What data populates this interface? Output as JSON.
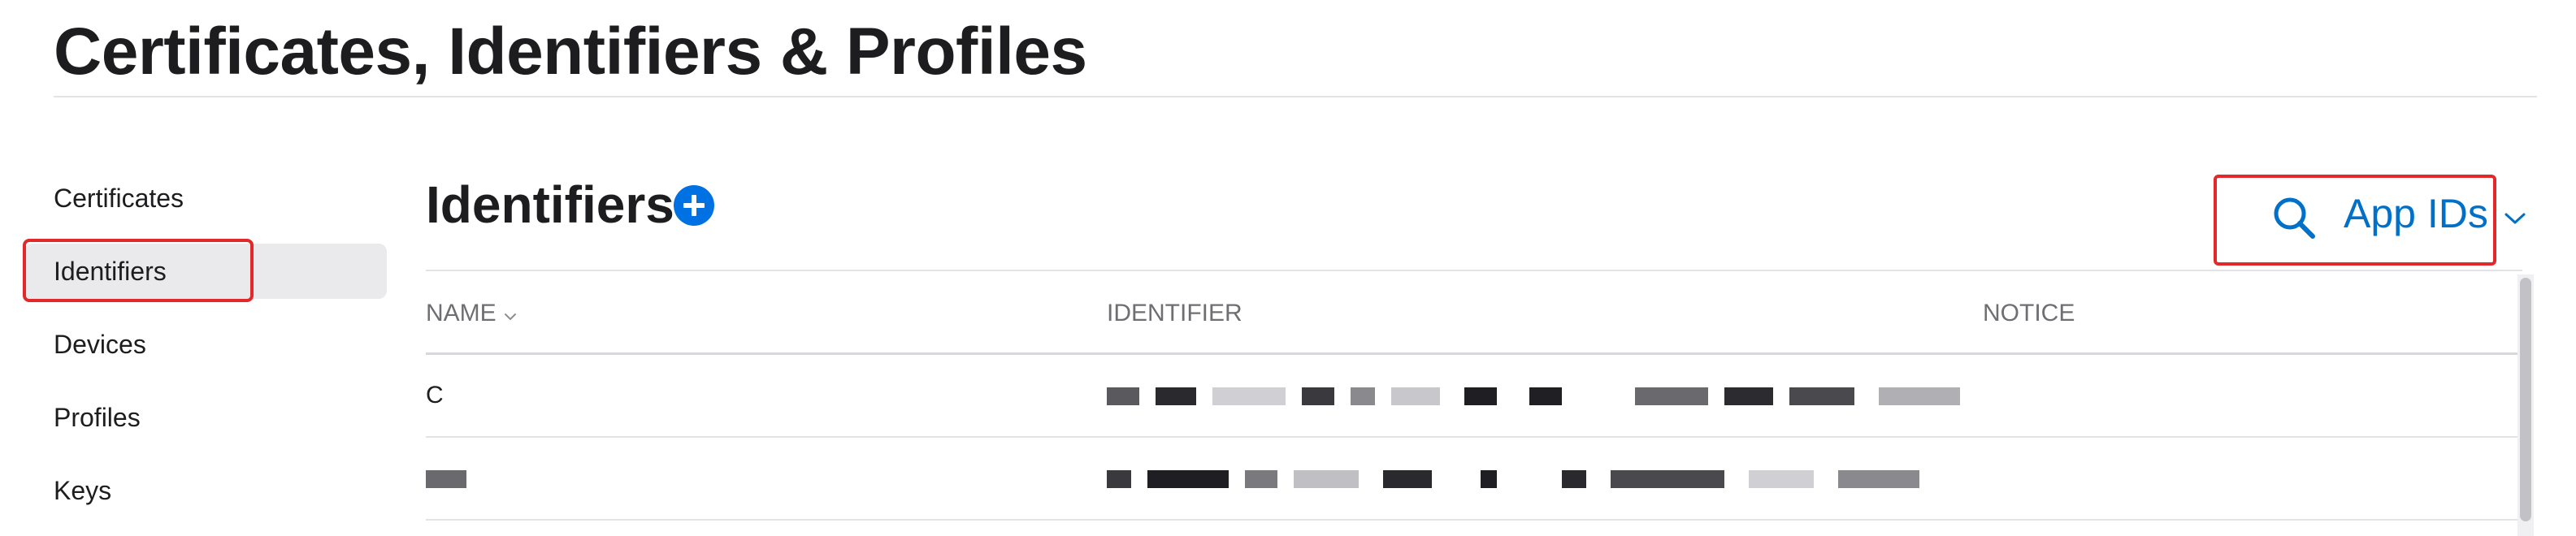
{
  "page": {
    "title": "Certificates, Identifiers & Profiles"
  },
  "sidebar": {
    "items": [
      {
        "label": "Certificates",
        "active": false
      },
      {
        "label": "Identifiers",
        "active": true
      },
      {
        "label": "Devices",
        "active": false
      },
      {
        "label": "Profiles",
        "active": false
      },
      {
        "label": "Keys",
        "active": false
      }
    ]
  },
  "main": {
    "section_title": "Identifiers",
    "add_icon": "plus-circle-icon",
    "filter": {
      "search_icon": "search-icon",
      "selected": "App IDs",
      "chevron_icon": "chevron-down-icon"
    },
    "table": {
      "columns": [
        "NAME",
        "IDENTIFIER",
        "NOTICE"
      ],
      "rows": [
        {
          "name": "C",
          "identifier": "",
          "notice": ""
        },
        {
          "name": "",
          "identifier": "",
          "notice": ""
        }
      ]
    }
  },
  "colors": {
    "accent": "#0071e3",
    "link": "#0070c9",
    "highlight": "#e3282a",
    "active_bg": "#eaeaec"
  }
}
